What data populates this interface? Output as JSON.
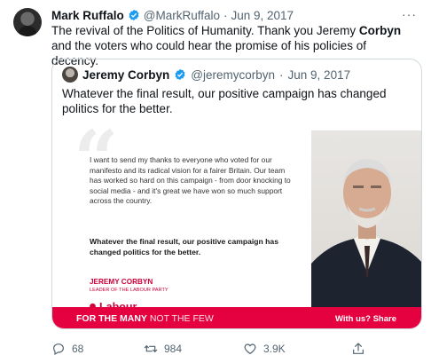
{
  "tweet": {
    "author_name": "Mark Ruffalo",
    "handle": "@MarkRuffalo",
    "separator": "·",
    "date": "Jun 9, 2017",
    "more_label": "···",
    "text_part1": "The revival of the Politics of Humanity.  Thank you Jeremy ",
    "text_bold": "Corbyn",
    "text_part2": " and the voters who could hear the promise of his policies of decency."
  },
  "quote": {
    "author_name": "Jeremy Corbyn",
    "handle": "@jeremycorbyn",
    "separator": "·",
    "date": "Jun 9, 2017",
    "text": "Whatever the final result, our positive campaign has changed politics for the better.",
    "poster": {
      "quote_mark": "“",
      "body": "I want to send my thanks to everyone who voted for our manifesto and its radical vision for a fairer Britain. Our team has worked so hard on this campaign - from door knocking to social media - and it's great we have won so much support across the country.",
      "bold": "Whatever the final result, our positive campaign has changed politics for the better.",
      "signature_name": "JEREMY CORBYN",
      "signature_title": "LEADER OF THE LABOUR PARTY",
      "logo_text": "Labour",
      "banner_bold": "FOR THE MANY",
      "banner_thin": " NOT THE FEW",
      "banner_right": "With us? Share"
    }
  },
  "actions": {
    "replies": "68",
    "retweets": "984",
    "likes": "3.9K"
  },
  "colors": {
    "verified": "#1d9bf0",
    "labour_red": "#e5003f",
    "muted": "#536471"
  }
}
